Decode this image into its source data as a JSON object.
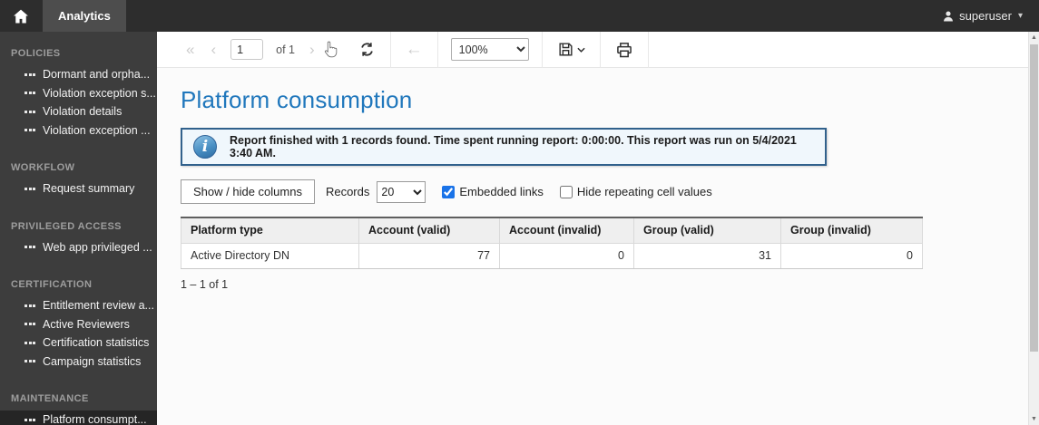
{
  "top_bar": {
    "app_tab": "Analytics",
    "user_name": "superuser",
    "user_caret": "▾"
  },
  "sidebar": {
    "sections": [
      {
        "title": "POLICIES",
        "items": [
          "Dormant and orpha...",
          "Violation exception s...",
          "Violation details",
          "Violation exception ..."
        ]
      },
      {
        "title": "WORKFLOW",
        "items": [
          "Request summary"
        ]
      },
      {
        "title": "PRIVILEGED ACCESS",
        "items": [
          "Web app privileged ..."
        ]
      },
      {
        "title": "CERTIFICATION",
        "items": [
          "Entitlement review a...",
          "Active Reviewers",
          "Certification statistics",
          "Campaign statistics"
        ]
      },
      {
        "title": "MAINTENANCE",
        "items": [
          "Platform consumpt..."
        ],
        "selected_item": "Platform consumpt..."
      }
    ]
  },
  "toolbar": {
    "first_page_icon": "«",
    "prev_page_icon": "‹",
    "page_value": "1",
    "page_of_label": "of 1",
    "next_page_icon": "›",
    "back_arrow_icon": "←",
    "zoom_value": "100%"
  },
  "report": {
    "title": "Platform consumption",
    "info_icon_glyph": "i",
    "info_message": "Report finished with 1 records found. Time spent running report: 0:00:00. This report was run on 5/4/2021 3:40 AM.",
    "controls": {
      "show_hide_button": "Show / hide columns",
      "records_label": "Records",
      "records_value": "20",
      "embedded_links_label": "Embedded links",
      "embedded_links_checked": true,
      "hide_repeating_label": "Hide repeating cell values",
      "hide_repeating_checked": false
    },
    "table": {
      "columns": [
        "Platform type",
        "Account (valid)",
        "Account (invalid)",
        "Group (valid)",
        "Group (invalid)"
      ],
      "rows": [
        {
          "platform_type": "Active Directory DN",
          "account_valid": "77",
          "account_invalid": "0",
          "group_valid": "31",
          "group_invalid": "0"
        }
      ]
    },
    "pagination": "1 – 1 of 1"
  },
  "scrollbar": {
    "up_arrow": "▲",
    "down_arrow": "▼"
  },
  "colors": {
    "accent_blue": "#2077bc",
    "banner_border": "#31618c",
    "banner_bg": "#f0f7fc",
    "checkbox_blue": "#1a73e8",
    "topbar_bg": "#2d2d2d",
    "sidebar_bg": "#3d3d3d",
    "selected_item_bg": "#252525"
  }
}
